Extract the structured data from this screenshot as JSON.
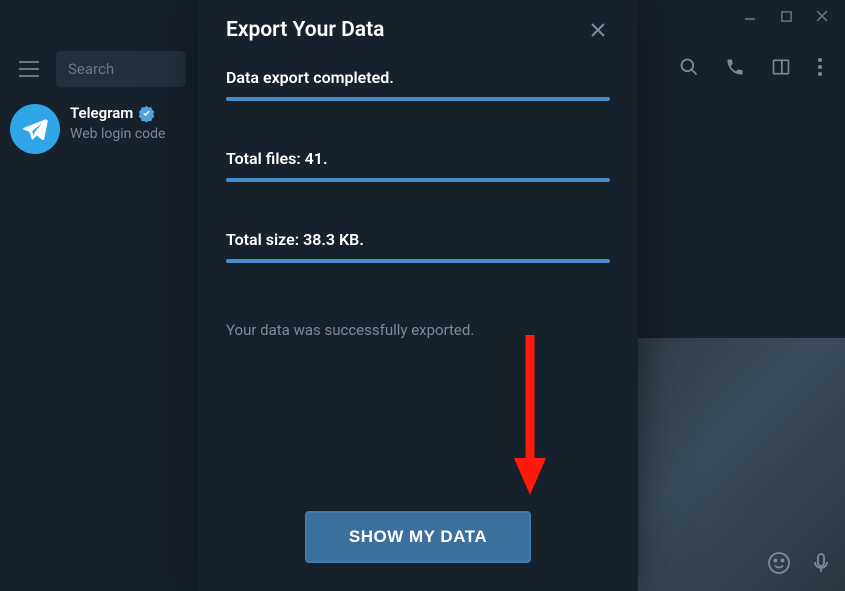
{
  "window": {
    "minimize": "—",
    "maximize": "☐",
    "close": "✕"
  },
  "toolbar": {
    "search_placeholder": "Search"
  },
  "chat_list": {
    "items": [
      {
        "name": "Telegram",
        "preview": "Web login code",
        "verified": true
      }
    ]
  },
  "modal": {
    "title": "Export Your Data",
    "stats": [
      "Data export completed.",
      "Total files: 41.",
      "Total size: 38.3 KB."
    ],
    "success_message": "Your data was successfully exported.",
    "button_label": "SHOW MY DATA"
  },
  "colors": {
    "accent": "#4a8bc9",
    "button": "#3d6f9e",
    "arrow": "#ff1a0d"
  }
}
